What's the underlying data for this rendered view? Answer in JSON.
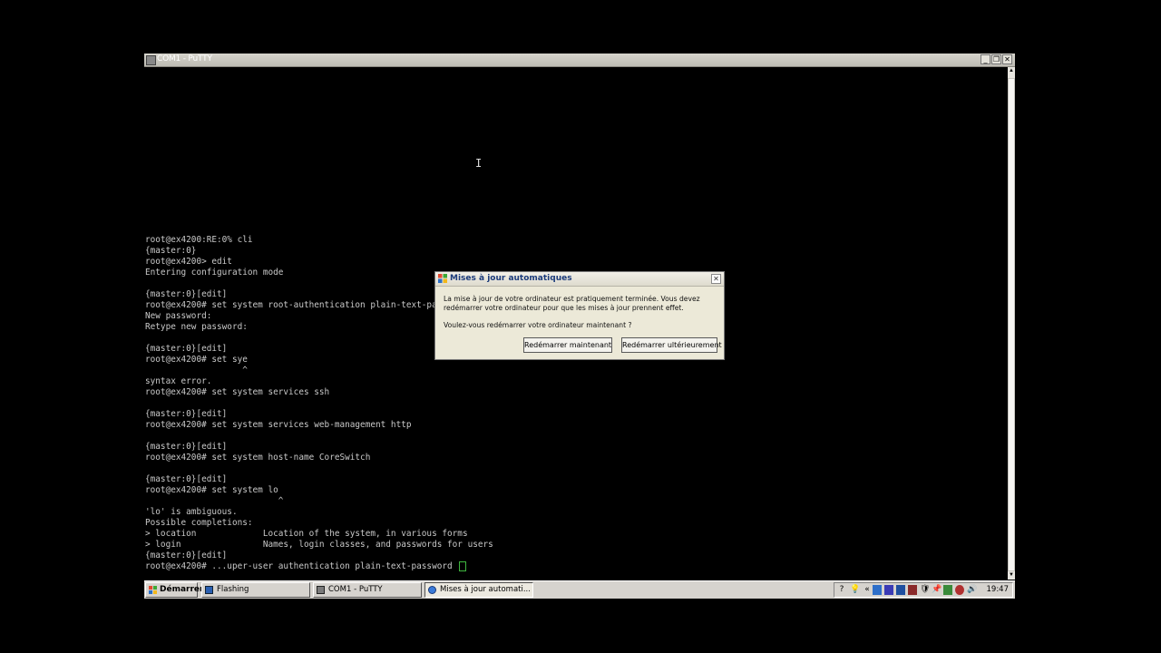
{
  "window": {
    "title": "COM1 - PuTTY"
  },
  "terminal": {
    "lines": [
      "root@ex4200:RE:0% cli",
      "{master:0}",
      "root@ex4200> edit",
      "Entering configuration mode",
      "",
      "{master:0}[edit]",
      "root@ex4200# set system root-authentication plain-text-password",
      "New password:",
      "Retype new password:",
      "",
      "{master:0}[edit]",
      "root@ex4200# set sye",
      "                   ^",
      "syntax error.",
      "root@ex4200# set system services ssh",
      "",
      "{master:0}[edit]",
      "root@ex4200# set system services web-management http",
      "",
      "{master:0}[edit]",
      "root@ex4200# set system host-name CoreSwitch",
      "",
      "{master:0}[edit]",
      "root@ex4200# set system lo",
      "                          ^",
      "'lo' is ambiguous.",
      "Possible completions:",
      "> location             Location of the system, in various forms",
      "> login                Names, login classes, and passwords for users",
      "{master:0}[edit]",
      "root@ex4200# ...uper-user authentication plain-text-password "
    ]
  },
  "dialog": {
    "title": "Mises à jour automatiques",
    "message_line1": "La mise à jour de votre ordinateur est pratiquement terminée. Vous devez",
    "message_line2": "redémarrer votre ordinateur pour que les mises à jour prennent effet.",
    "question": "Voulez-vous redémarrer votre ordinateur maintenant ?",
    "restart_now_label": "Redémarrer maintenant",
    "restart_later_label": "Redémarrer ultérieurement"
  },
  "taskbar": {
    "start_label": "Démarrer",
    "tasks": [
      {
        "label": "Flashing"
      },
      {
        "label": "COM1 - PuTTY"
      },
      {
        "label": "Mises à jour automati..."
      }
    ],
    "clock": "19:47"
  },
  "colors": {
    "terminal_bg": "#000000",
    "terminal_fg": "#c9c9c9",
    "cursor": "#3fb63f",
    "dialog_bg": "#ece9d8",
    "taskbar_bg": "#d6d3ce"
  }
}
